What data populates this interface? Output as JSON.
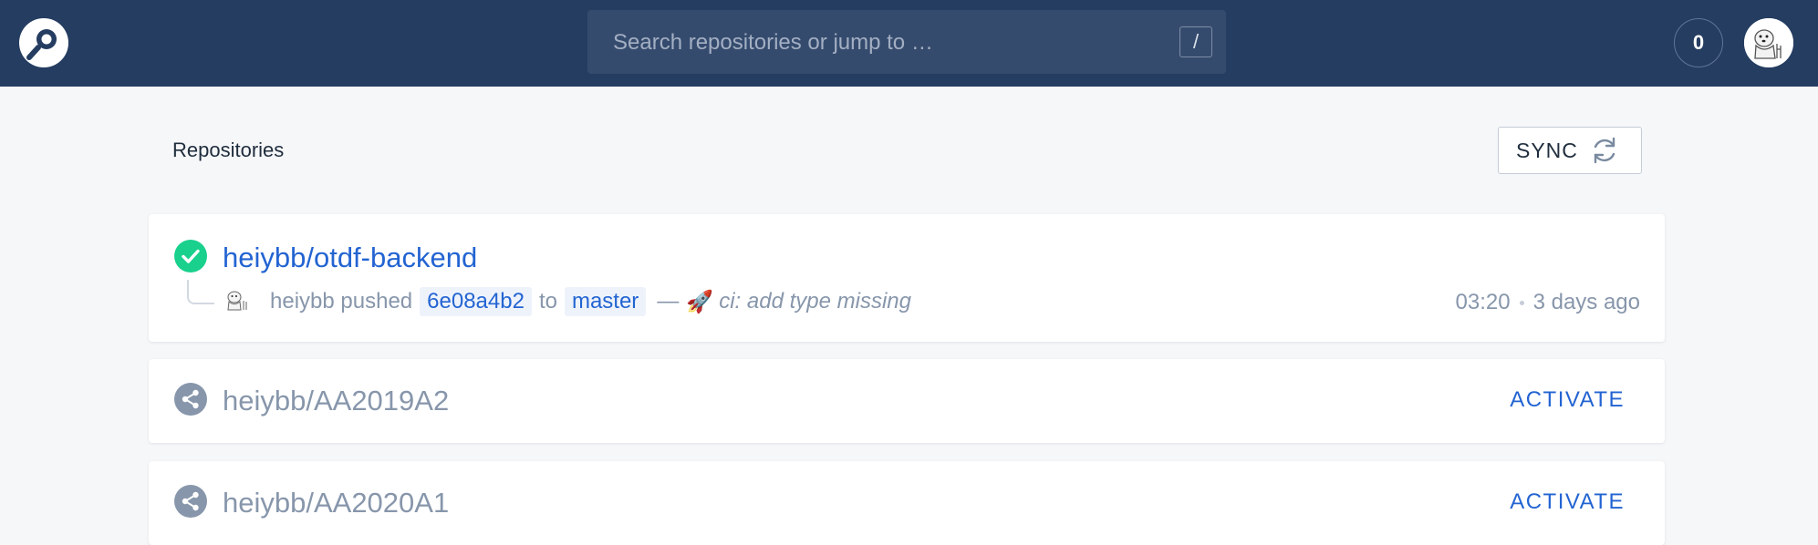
{
  "header": {
    "logo_icon": "drone-logo-icon",
    "search_placeholder": "Search repositories or jump to …",
    "search_shortcut": "/",
    "notification_count": "0",
    "colors": {
      "background": "#253d61",
      "search_bg": "#354b6e"
    }
  },
  "main": {
    "title": "Repositories",
    "sync_label": "SYNC",
    "sync_icon": "refresh-icon"
  },
  "repos": [
    {
      "name": "heiybb/otdf-backend",
      "active": true,
      "status_icon": "success-check-icon",
      "status_color": "#19d08d",
      "commit": {
        "author": "heiybb",
        "action": "pushed",
        "sha": "6e08a4b2",
        "to": "to",
        "branch": "master",
        "dash": "—",
        "message": "ci: add type missing",
        "emoji": "🚀",
        "time": "03:20",
        "ago": "3 days ago"
      }
    },
    {
      "name": "heiybb/AA2019A2",
      "active": false,
      "icon": "share-icon",
      "action_label": "ACTIVATE"
    },
    {
      "name": "heiybb/AA2020A1",
      "active": false,
      "icon": "share-icon",
      "action_label": "ACTIVATE"
    }
  ],
  "colors": {
    "link": "#2364d2",
    "muted": "#8796ab",
    "page_bg": "#f6f7f9"
  }
}
